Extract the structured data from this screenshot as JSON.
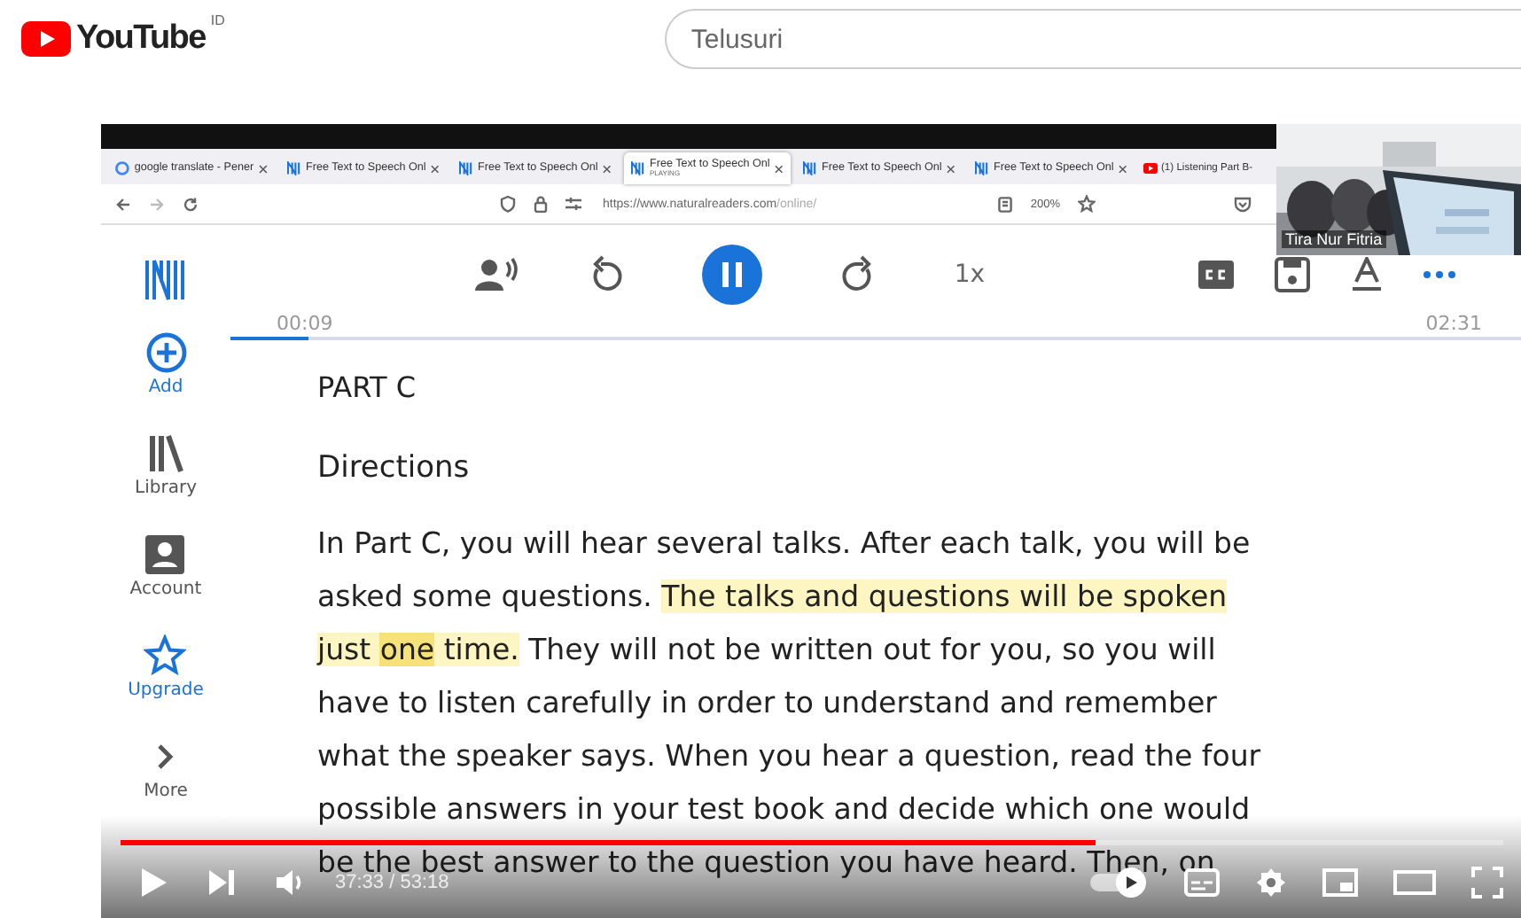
{
  "header": {
    "logo": "YouTube",
    "region": "ID",
    "search": {
      "placeholder": "Telusuri"
    }
  },
  "video": {
    "browser": {
      "tabs": [
        {
          "title": "google translate - Pener",
          "kind": "google",
          "selected": false
        },
        {
          "title": "Free Text to Speech Onl",
          "kind": "app",
          "selected": false
        },
        {
          "title": "Free Text to Speech Onl",
          "kind": "app",
          "selected": false
        },
        {
          "title": "Free Text to Speech Onl",
          "subtitle": "PLAYING",
          "kind": "app",
          "selected": true
        },
        {
          "title": "Free Text to Speech Onl",
          "kind": "app",
          "selected": false
        },
        {
          "title": "Free Text to Speech Onl",
          "kind": "app",
          "selected": false
        },
        {
          "title": "(1) Listening Part B-",
          "kind": "video",
          "selected": false
        }
      ],
      "url_host": "https://www.naturalreaders.com",
      "url_path": "/online/",
      "zoom": "200%"
    },
    "app": {
      "sidebar": [
        {
          "label": "Add",
          "kind": "add",
          "color": "#1a73d9"
        },
        {
          "label": "Library",
          "kind": "library",
          "color": "#555555"
        },
        {
          "label": "Account",
          "kind": "account",
          "color": "#555555"
        },
        {
          "label": "Upgrade",
          "kind": "upgrade",
          "color": "#1a73d9"
        },
        {
          "label": "More",
          "kind": "more",
          "color": "#555555"
        }
      ],
      "player": {
        "playing": true,
        "speed": "1x",
        "elapsed": "00:09",
        "total": "02:31",
        "level": 0.06
      },
      "document": {
        "heading": "PART C",
        "subheading": "Directions",
        "lines": [
          [
            {
              "text": "In Part C, you will hear several talks. After each talk, you will be",
              "highlighted": false,
              "spoken": false
            }
          ],
          [
            {
              "text": "asked some questions. ",
              "highlighted": false,
              "spoken": false
            },
            {
              "text": "The talks and questions will be spoken",
              "highlighted": true,
              "spoken": false
            }
          ],
          [
            {
              "text": "just ",
              "highlighted": true,
              "spoken": false
            },
            {
              "text": "one",
              "highlighted": true,
              "spoken": true
            },
            {
              "text": " time.",
              "highlighted": true,
              "spoken": false
            },
            {
              "text": " They will not be written out for you, so you will",
              "highlighted": false,
              "spoken": false
            }
          ],
          [
            {
              "text": "have to listen carefully in order to understand and remember",
              "highlighted": false,
              "spoken": false
            }
          ],
          [
            {
              "text": "what the speaker says. When you hear a question, read the four",
              "highlighted": false,
              "spoken": false
            }
          ],
          [
            {
              "text": "possible answers in your test book and decide which one would",
              "highlighted": false,
              "spoken": false
            }
          ],
          [
            {
              "text": "be the best answer to the question you have heard. Then, on",
              "highlighted": false,
              "spoken": false
            }
          ]
        ]
      }
    },
    "webcam": {
      "name": "Tira Nur Fitria"
    },
    "controls": {
      "time": "37:33 / 53:18",
      "level": 0.705,
      "autoplay": true
    }
  }
}
